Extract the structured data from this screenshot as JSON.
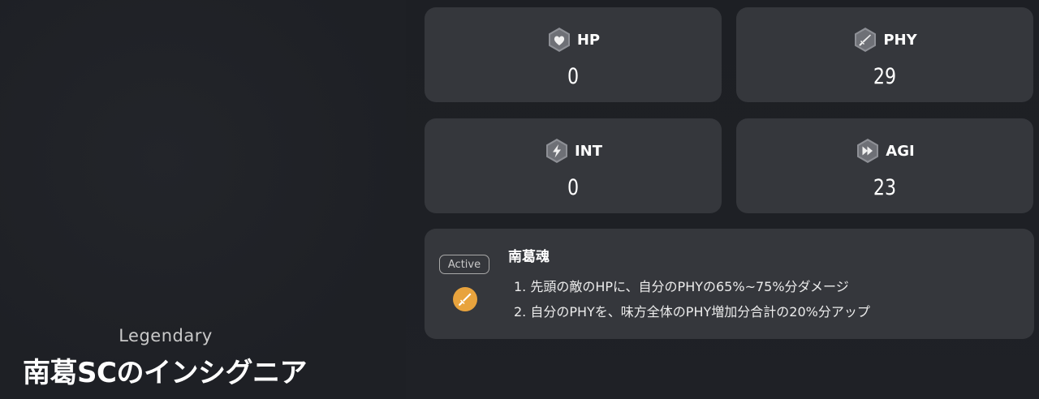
{
  "card": {
    "rarity": "Legendary",
    "name": "南葛SCのインシグニア"
  },
  "stats": [
    {
      "label": "HP",
      "value": "0",
      "icon": "heart-icon"
    },
    {
      "label": "PHY",
      "value": "29",
      "icon": "sword-icon"
    },
    {
      "label": "INT",
      "value": "0",
      "icon": "lightning-icon"
    },
    {
      "label": "AGI",
      "value": "23",
      "icon": "fast-forward-icon"
    }
  ],
  "skill": {
    "badge": "Active",
    "icon": "sword-icon",
    "title": "南葛魂",
    "lines": [
      "1. 先頭の敵のHPに、自分のPHYの65%~75%分ダメージ",
      "2. 自分のPHYを、味方全体のPHY増加分合計の20%分アップ"
    ]
  },
  "colors": {
    "background": "#1e2025",
    "panel": "#35373c",
    "skill_icon": "#e8a33d",
    "stat_icon": "#8e9096"
  }
}
